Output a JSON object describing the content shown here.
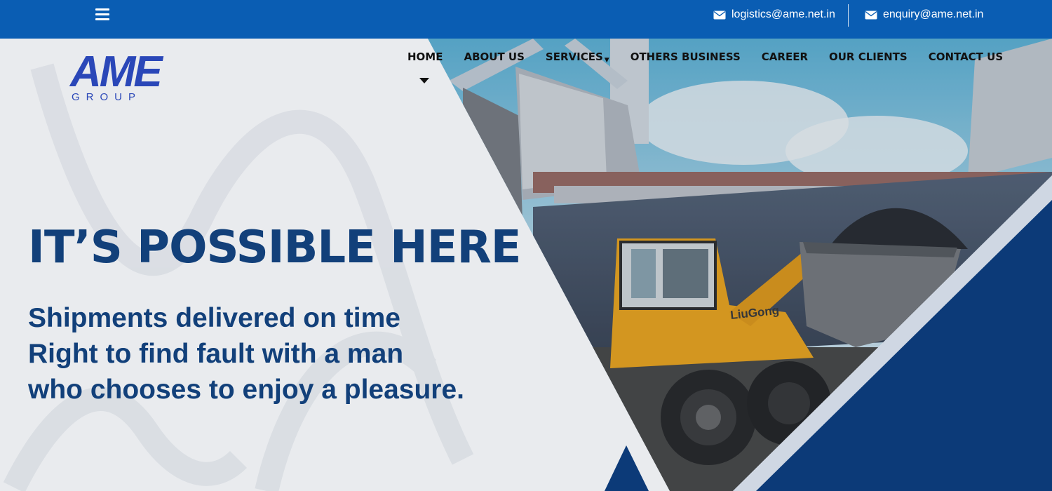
{
  "topbar": {
    "menu_icon": "hamburger-icon",
    "email_icon": "envelope-icon",
    "contacts": [
      {
        "label": "logistics@ame.net.in"
      },
      {
        "label": "enquiry@ame.net.in"
      }
    ],
    "color": "#0a5db3"
  },
  "logo": {
    "mark": "AME",
    "sub": "GROUP"
  },
  "nav": {
    "items": [
      {
        "label": "HOME"
      },
      {
        "label": "ABOUT US"
      },
      {
        "label": "SERVICES"
      },
      {
        "label": "OTHERS BUSINESS"
      },
      {
        "label": "CAREER"
      },
      {
        "label": "OUR CLIENTS"
      },
      {
        "label": "CONTACT US"
      }
    ]
  },
  "hero": {
    "headline": "IT’S POSSIBLE HERE",
    "lines": [
      "Shipments delivered on time",
      "Right to find fault with a man",
      "who chooses to enjoy a pleasure."
    ],
    "text_color": "#12407a",
    "accent_dark": "#0c3a78",
    "image": "ship-cargo-loader-photo"
  }
}
